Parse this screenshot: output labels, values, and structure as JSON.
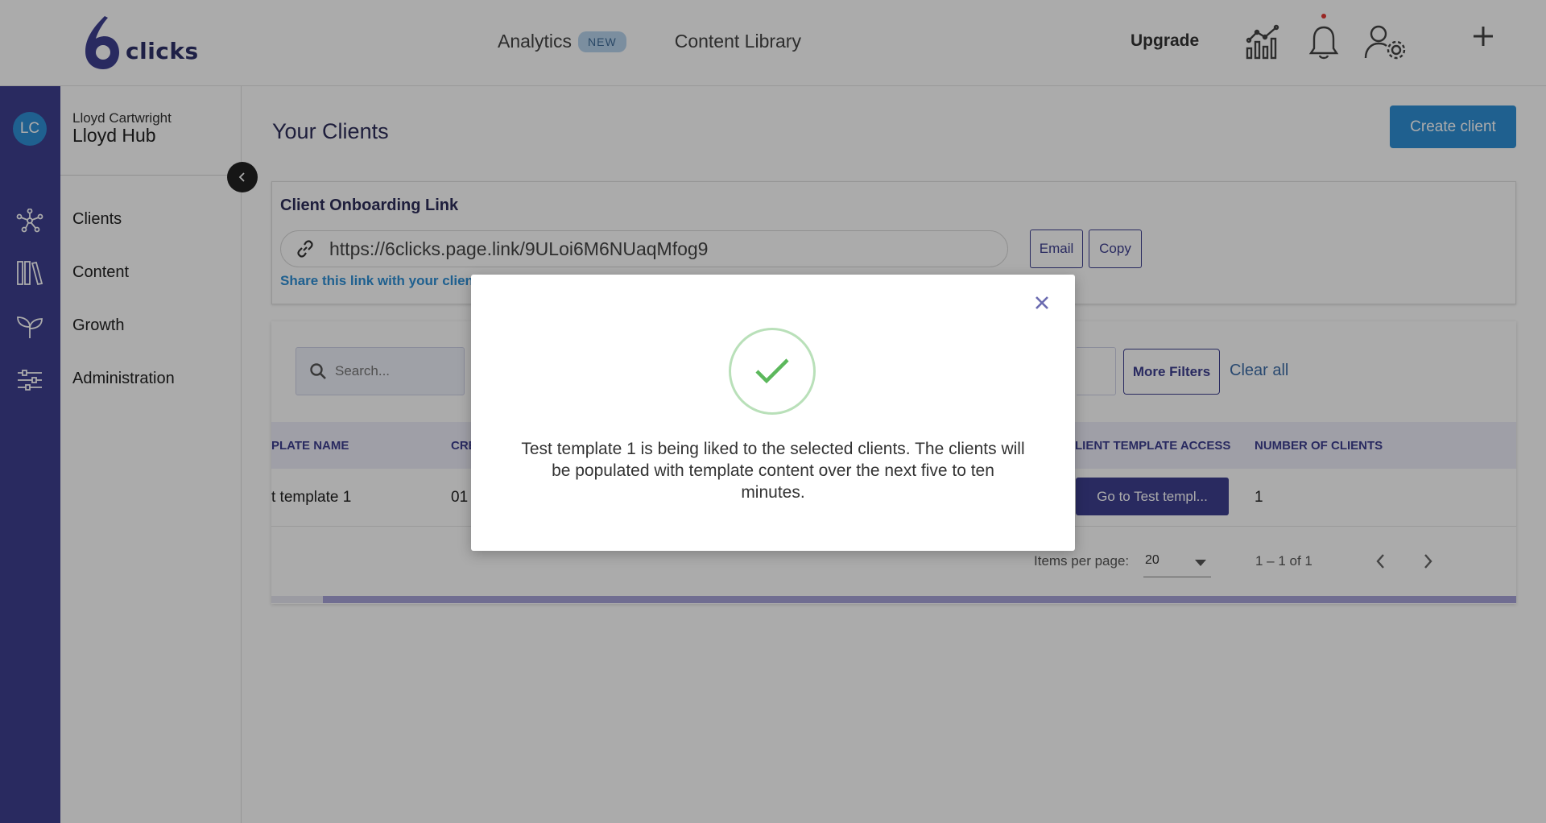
{
  "header": {
    "logo_text": "clicks",
    "nav": {
      "analytics_label": "Analytics",
      "analytics_badge": "NEW",
      "content_library_label": "Content Library"
    },
    "upgrade_label": "Upgrade"
  },
  "sidebar": {
    "avatar_initials": "LC",
    "user_name": "Lloyd Cartwright",
    "hub_name": "Lloyd Hub",
    "items": [
      {
        "label": "Clients"
      },
      {
        "label": "Content"
      },
      {
        "label": "Growth"
      },
      {
        "label": "Administration"
      }
    ]
  },
  "main": {
    "title": "Your Clients",
    "create_button": "Create client",
    "onboarding": {
      "title": "Client Onboarding Link",
      "link": "https://6clicks.page.link/9ULoi6M6NUaqMfog9",
      "email_button": "Email",
      "copy_button": "Copy",
      "share_text": "Share this link with your client"
    },
    "filters": {
      "search_placeholder": "Search...",
      "more_filters": "More Filters",
      "clear_all": "Clear all"
    },
    "table": {
      "columns": [
        "PLATE NAME",
        "CRE",
        "LIENT TEMPLATE ACCESS",
        "NUMBER OF CLIENTS"
      ],
      "rows": [
        {
          "name": "t template 1",
          "created": "01",
          "access_button": "Go to Test templ...",
          "count": "1"
        }
      ]
    },
    "pagination": {
      "items_per_page_label": "Items per page:",
      "items_per_page_value": "20",
      "range": "1 – 1 of 1"
    }
  },
  "modal": {
    "message": "Test template 1 is being liked to the selected clients. The clients will be populated with template content over the next five to ten minutes."
  },
  "colors": {
    "brand_primary": "#3e3f90",
    "accent_blue": "#2f8fd6",
    "success_green": "#5cb85c"
  }
}
